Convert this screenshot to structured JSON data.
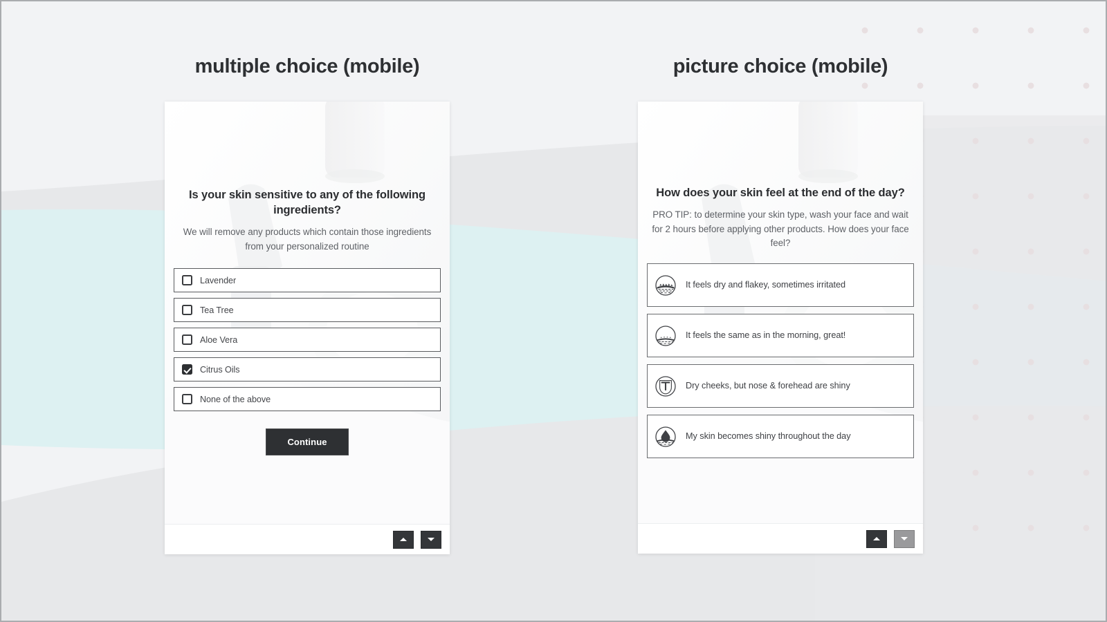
{
  "page": {
    "background_color": "#f2f3f5",
    "accent_mint": "#ddf1f2",
    "accent_grey": "#e7e8ea",
    "dot_color": "#e7dee0",
    "dark": "#2e3033"
  },
  "columns": [
    {
      "title": "multiple choice (mobile)",
      "screen": {
        "question": "Is your skin sensitive to any of the following ingredients?",
        "subtext": "We will remove any products which contain those ingredients from your personalized routine",
        "type": "checkbox",
        "options": [
          {
            "label": "Lavender",
            "checked": false
          },
          {
            "label": "Tea Tree",
            "checked": false
          },
          {
            "label": "Aloe Vera",
            "checked": false
          },
          {
            "label": "Citrus Oils",
            "checked": true
          },
          {
            "label": "None of the above",
            "checked": false
          }
        ],
        "submit_label": "Continue",
        "scroll_up": {
          "icon": "triangle-up-icon",
          "state": "enabled"
        },
        "scroll_down": {
          "icon": "triangle-down-icon",
          "state": "enabled"
        }
      }
    },
    {
      "title": "picture choice (mobile)",
      "screen": {
        "question": "How does your skin feel at the end of the day?",
        "subtext": "PRO TIP: to determine your skin type, wash your face and wait for 2 hours before applying other products. How does your face feel?",
        "type": "picture",
        "options": [
          {
            "label": "It feels dry and flakey, sometimes irritated",
            "icon": "dry-skin-icon"
          },
          {
            "label": "It feels the same as in the morning, great!",
            "icon": "normal-skin-icon"
          },
          {
            "label": "Dry cheeks, but nose & forehead are shiny",
            "icon": "t-zone-icon"
          },
          {
            "label": "My skin becomes shiny throughout the day",
            "icon": "oily-droplet-icon"
          }
        ],
        "scroll_up": {
          "icon": "triangle-up-icon",
          "state": "enabled"
        },
        "scroll_down": {
          "icon": "triangle-down-icon",
          "state": "disabled"
        }
      }
    }
  ]
}
